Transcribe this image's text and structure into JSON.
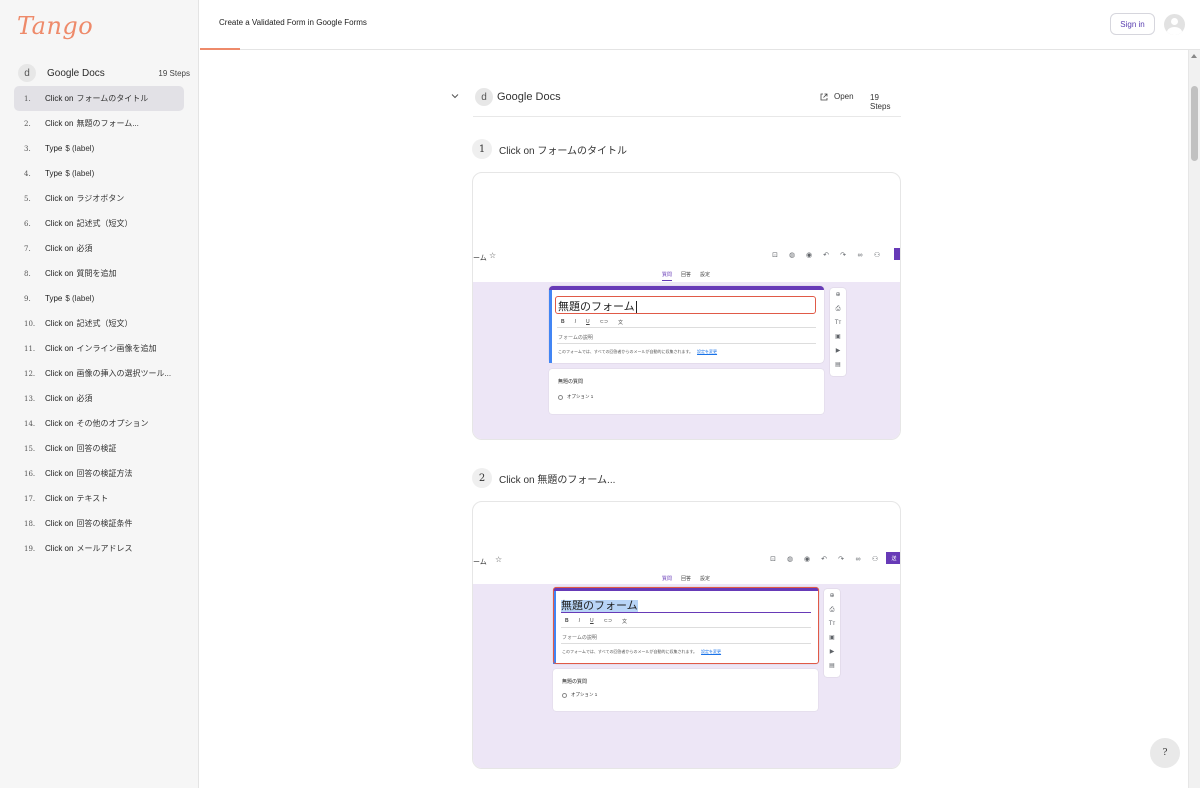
{
  "app": {
    "logo": "Tango"
  },
  "header": {
    "page_title": "Create a Validated Form in Google Forms",
    "sign_in": "Sign in"
  },
  "sidebar": {
    "badge": "d",
    "workflow_title": "Google Docs",
    "steps_count": "19 Steps",
    "steps": [
      {
        "num": "1.",
        "action": "Click on",
        "target": "フォームのタイトル"
      },
      {
        "num": "2.",
        "action": "Click on",
        "target": "無題のフォーム..."
      },
      {
        "num": "3.",
        "action": "Type",
        "target": "$ (label)"
      },
      {
        "num": "4.",
        "action": "Type",
        "target": "$ (label)"
      },
      {
        "num": "5.",
        "action": "Click on",
        "target": "ラジオボタン"
      },
      {
        "num": "6.",
        "action": "Click on",
        "target": "記述式（短文）"
      },
      {
        "num": "7.",
        "action": "Click on",
        "target": "必須"
      },
      {
        "num": "8.",
        "action": "Click on",
        "target": "質問を追加"
      },
      {
        "num": "9.",
        "action": "Type",
        "target": "$ (label)"
      },
      {
        "num": "10.",
        "action": "Click on",
        "target": "記述式（短文）"
      },
      {
        "num": "11.",
        "action": "Click on",
        "target": "インライン画像を追加"
      },
      {
        "num": "12.",
        "action": "Click on",
        "target": "画像の挿入の選択ツール..."
      },
      {
        "num": "13.",
        "action": "Click on",
        "target": "必須"
      },
      {
        "num": "14.",
        "action": "Click on",
        "target": "その他のオプション"
      },
      {
        "num": "15.",
        "action": "Click on",
        "target": "回答の検証"
      },
      {
        "num": "16.",
        "action": "Click on",
        "target": "回答の検証方法"
      },
      {
        "num": "17.",
        "action": "Click on",
        "target": "テキスト"
      },
      {
        "num": "18.",
        "action": "Click on",
        "target": "回答の検証条件"
      },
      {
        "num": "19.",
        "action": "Click on",
        "target": "メールアドレス"
      }
    ]
  },
  "main": {
    "badge": "d",
    "workflow_title": "Google Docs",
    "open_label": "Open",
    "steps_count": "19 Steps",
    "step1": {
      "num": "1",
      "action": "Click on",
      "target": "フォームのタイトル"
    },
    "step2": {
      "num": "2",
      "action": "Click on",
      "target": "無題のフォーム..."
    },
    "form": {
      "title_fragment": "ーム",
      "tabs": [
        "質問",
        "回答",
        "設定"
      ],
      "form_title": "無題のフォーム",
      "format_buttons": [
        "B",
        "I",
        "U",
        "⊂⊃",
        "文"
      ],
      "description_placeholder": "フォームの説明",
      "email_note": "このフォームでは、すべての回答者からのメールが自動的に収集されます。",
      "settings_link": "設定を変更",
      "question_title": "無題の質問",
      "option_label": "オプション 1",
      "send_fragment": "送",
      "toolbar_icons": [
        "palette-icon",
        "preview-icon",
        "undo-icon",
        "redo-icon",
        "link-icon",
        "add-person-icon"
      ],
      "side_tools": [
        "add-question-icon",
        "import-icon",
        "title-icon",
        "image-icon",
        "video-icon",
        "section-icon"
      ],
      "side_tool_glyphs": [
        "⊕",
        "⎙",
        "Tт",
        "▣",
        "▶",
        "▤"
      ]
    }
  },
  "help_label": "?",
  "colors": {
    "accent": "#673ab7",
    "brand": "#ee8a6a",
    "highlight": "#e05a47",
    "canvas": "#ede6f6"
  }
}
